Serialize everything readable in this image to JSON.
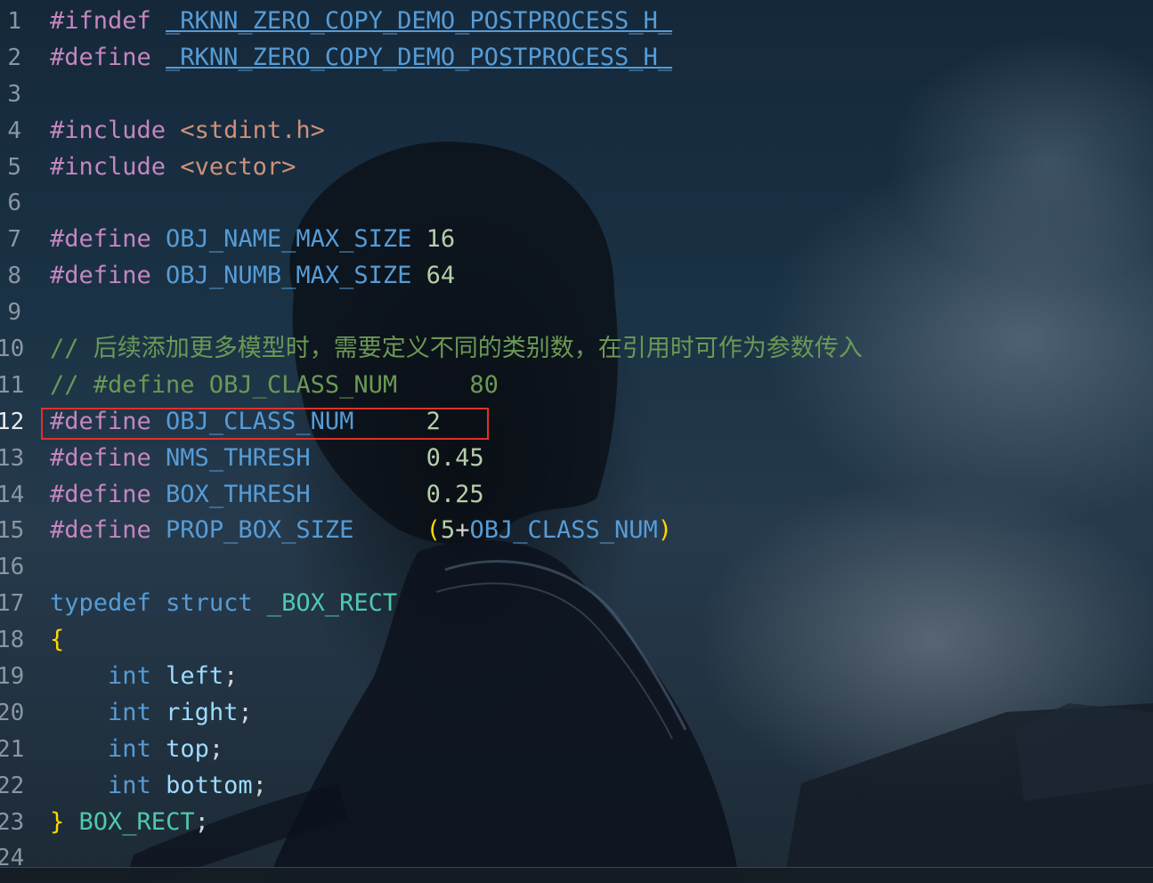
{
  "editor": {
    "active_line": 12,
    "lines": [
      {
        "n": "1",
        "parts": [
          {
            "t": "#ifndef ",
            "c": "pre"
          },
          {
            "t": "_RKNN_ZERO_COPY_DEMO_POSTPROCESS_H_",
            "c": "macroU"
          }
        ]
      },
      {
        "n": "2",
        "parts": [
          {
            "t": "#define ",
            "c": "pre"
          },
          {
            "t": "_RKNN_ZERO_COPY_DEMO_POSTPROCESS_H_",
            "c": "macroU"
          }
        ]
      },
      {
        "n": "3",
        "parts": []
      },
      {
        "n": "4",
        "parts": [
          {
            "t": "#include ",
            "c": "pre"
          },
          {
            "t": "<stdint.h>",
            "c": "str"
          }
        ]
      },
      {
        "n": "5",
        "parts": [
          {
            "t": "#include ",
            "c": "pre"
          },
          {
            "t": "<vector>",
            "c": "str"
          }
        ]
      },
      {
        "n": "6",
        "parts": []
      },
      {
        "n": "7",
        "parts": [
          {
            "t": "#define ",
            "c": "pre"
          },
          {
            "t": "OBJ_NAME_MAX_SIZE",
            "c": "macro"
          },
          {
            "t": " ",
            "c": "punct"
          },
          {
            "t": "16",
            "c": "num"
          }
        ]
      },
      {
        "n": "8",
        "parts": [
          {
            "t": "#define ",
            "c": "pre"
          },
          {
            "t": "OBJ_NUMB_MAX_SIZE",
            "c": "macro"
          },
          {
            "t": " ",
            "c": "punct"
          },
          {
            "t": "64",
            "c": "num"
          }
        ]
      },
      {
        "n": "9",
        "parts": []
      },
      {
        "n": "10",
        "parts": [
          {
            "t": "// 后续添加更多模型时，需要定义不同的类别数，在引用时可作为参数传入",
            "c": "cmt"
          }
        ]
      },
      {
        "n": "11",
        "parts": [
          {
            "t": "// #define OBJ_CLASS_NUM     80",
            "c": "cmt"
          }
        ]
      },
      {
        "n": "12",
        "parts": [
          {
            "t": "#define ",
            "c": "pre"
          },
          {
            "t": "OBJ_CLASS_NUM",
            "c": "macro"
          },
          {
            "t": "     ",
            "c": "punct"
          },
          {
            "t": "2",
            "c": "num"
          }
        ]
      },
      {
        "n": "13",
        "parts": [
          {
            "t": "#define ",
            "c": "pre"
          },
          {
            "t": "NMS_THRESH",
            "c": "macro"
          },
          {
            "t": "        ",
            "c": "punct"
          },
          {
            "t": "0.45",
            "c": "num"
          }
        ]
      },
      {
        "n": "14",
        "parts": [
          {
            "t": "#define ",
            "c": "pre"
          },
          {
            "t": "BOX_THRESH",
            "c": "macro"
          },
          {
            "t": "        ",
            "c": "punct"
          },
          {
            "t": "0.25",
            "c": "num"
          }
        ]
      },
      {
        "n": "15",
        "parts": [
          {
            "t": "#define ",
            "c": "pre"
          },
          {
            "t": "PROP_BOX_SIZE",
            "c": "macro"
          },
          {
            "t": "     ",
            "c": "punct"
          },
          {
            "t": "(",
            "c": "brace"
          },
          {
            "t": "5",
            "c": "num"
          },
          {
            "t": "+",
            "c": "punct"
          },
          {
            "t": "OBJ_CLASS_NUM",
            "c": "macro"
          },
          {
            "t": ")",
            "c": "brace"
          }
        ]
      },
      {
        "n": "16",
        "parts": []
      },
      {
        "n": "17",
        "parts": [
          {
            "t": "typedef",
            "c": "kw"
          },
          {
            "t": " ",
            "c": "punct"
          },
          {
            "t": "struct",
            "c": "kw"
          },
          {
            "t": " ",
            "c": "punct"
          },
          {
            "t": "_BOX_RECT",
            "c": "type"
          }
        ]
      },
      {
        "n": "18",
        "parts": [
          {
            "t": "{",
            "c": "brace"
          }
        ]
      },
      {
        "n": "19",
        "parts": [
          {
            "t": "    ",
            "c": "punct"
          },
          {
            "t": "int",
            "c": "kw"
          },
          {
            "t": " ",
            "c": "punct"
          },
          {
            "t": "left",
            "c": "var"
          },
          {
            "t": ";",
            "c": "punct"
          }
        ]
      },
      {
        "n": "20",
        "parts": [
          {
            "t": "    ",
            "c": "punct"
          },
          {
            "t": "int",
            "c": "kw"
          },
          {
            "t": " ",
            "c": "punct"
          },
          {
            "t": "right",
            "c": "var"
          },
          {
            "t": ";",
            "c": "punct"
          }
        ]
      },
      {
        "n": "21",
        "parts": [
          {
            "t": "    ",
            "c": "punct"
          },
          {
            "t": "int",
            "c": "kw"
          },
          {
            "t": " ",
            "c": "punct"
          },
          {
            "t": "top",
            "c": "var"
          },
          {
            "t": ";",
            "c": "punct"
          }
        ]
      },
      {
        "n": "22",
        "parts": [
          {
            "t": "    ",
            "c": "punct"
          },
          {
            "t": "int",
            "c": "kw"
          },
          {
            "t": " ",
            "c": "punct"
          },
          {
            "t": "bottom",
            "c": "var"
          },
          {
            "t": ";",
            "c": "punct"
          }
        ]
      },
      {
        "n": "23",
        "parts": [
          {
            "t": "}",
            "c": "brace"
          },
          {
            "t": " ",
            "c": "punct"
          },
          {
            "t": "BOX_RECT",
            "c": "type"
          },
          {
            "t": ";",
            "c": "punct"
          }
        ]
      },
      {
        "n": "24",
        "parts": []
      }
    ]
  },
  "highlight": {
    "line": 12,
    "color": "#e0302a"
  },
  "theme": {
    "preprocessor": "#c586c0",
    "macro": "#569cd6",
    "number": "#b5cea8",
    "string": "#ce9178",
    "comment": "#6a9955",
    "type": "#4ec9b0",
    "variable": "#9cdcfe",
    "brace": "#ffd700"
  }
}
